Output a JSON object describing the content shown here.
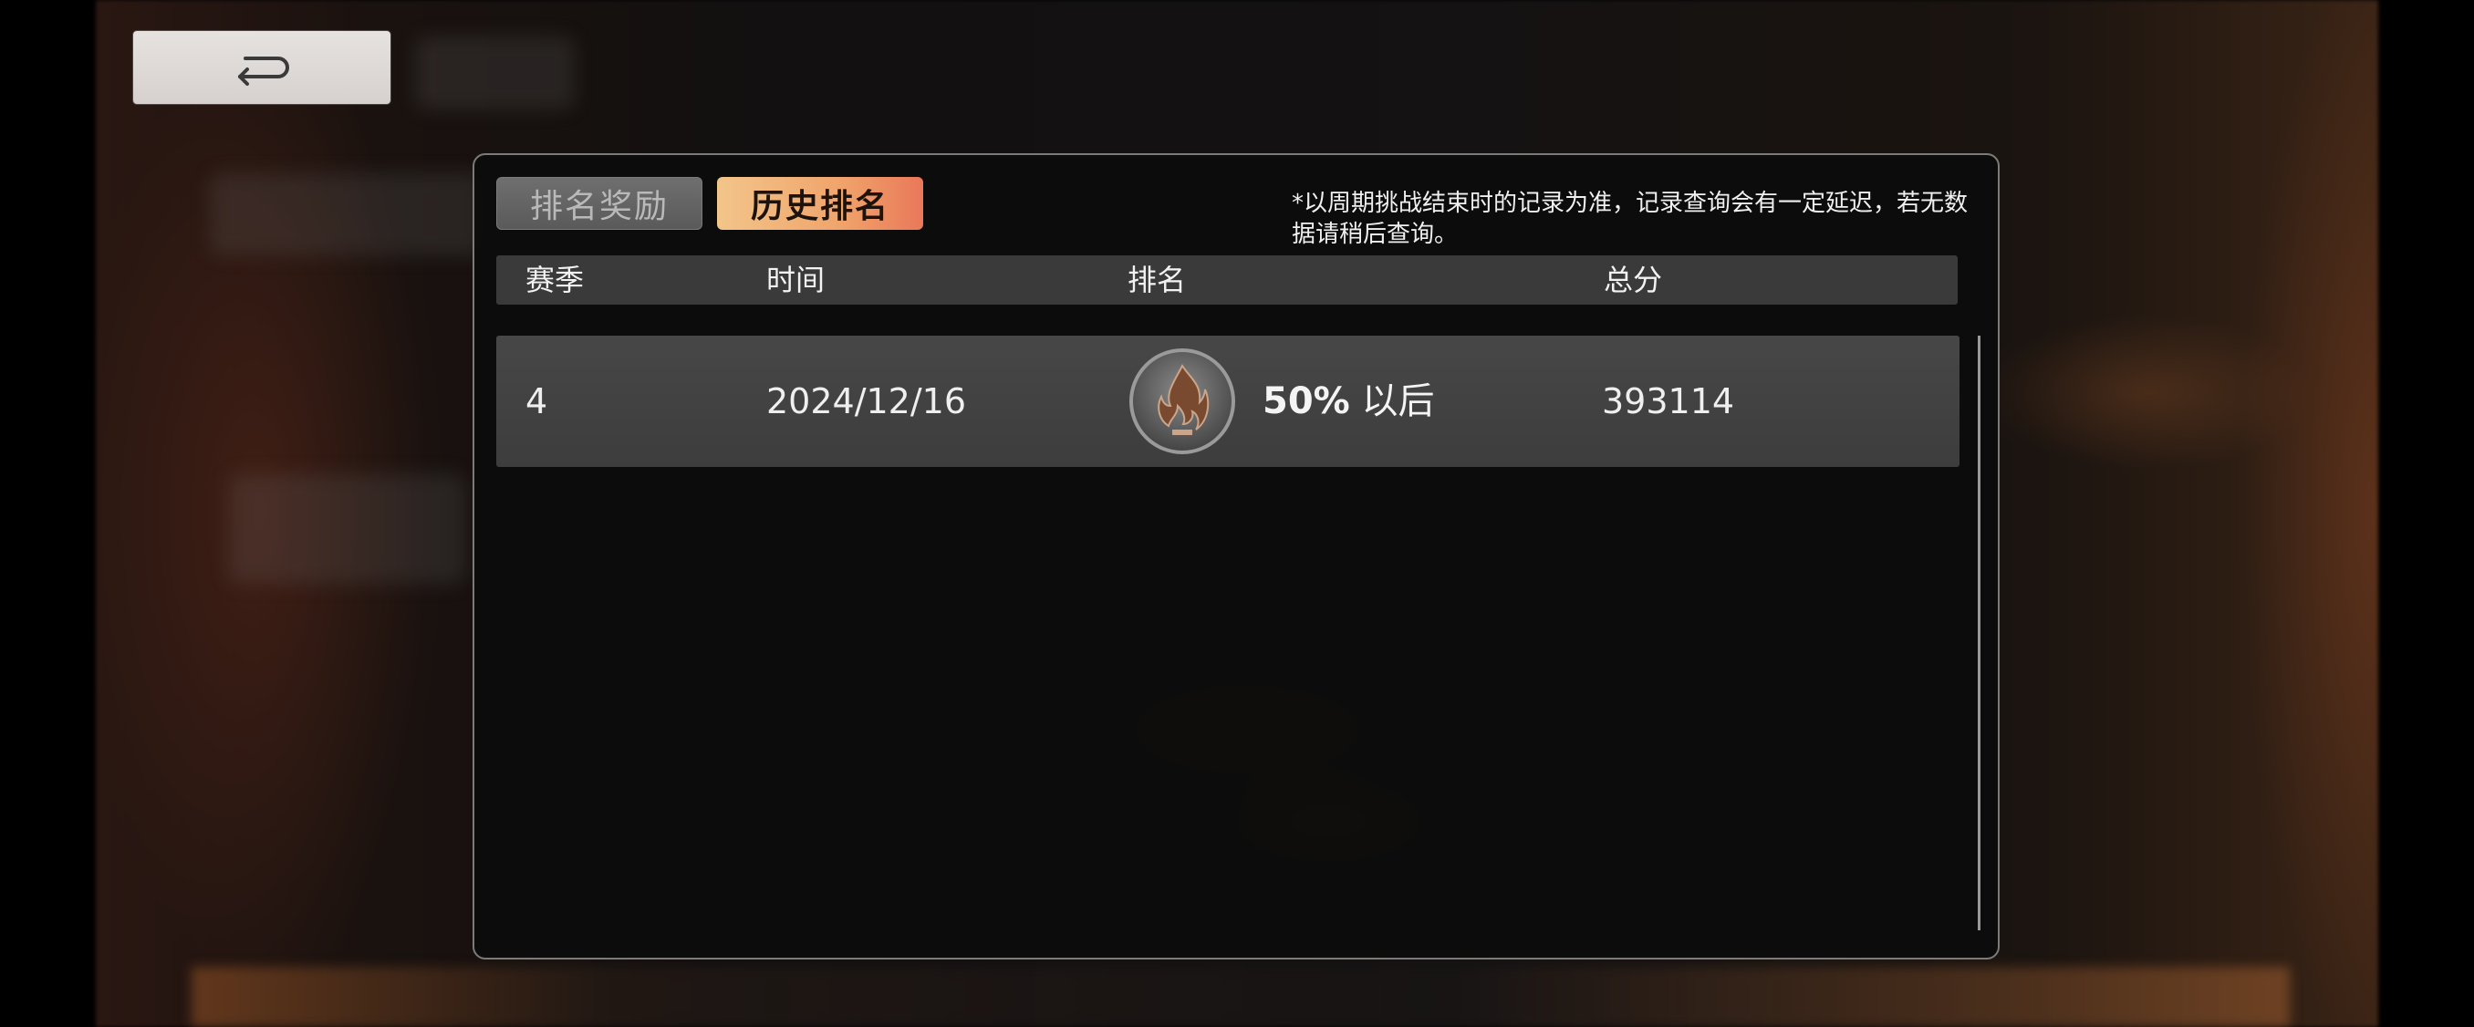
{
  "back_button": {
    "icon": "return-arrow-icon"
  },
  "tabs": [
    {
      "label": "排名奖励",
      "active": false
    },
    {
      "label": "历史排名",
      "active": true
    }
  ],
  "notice": "*以周期挑战结束时的记录为准，记录查询会有一定延迟，若无数据请稍后查询。",
  "table": {
    "columns": [
      "赛季",
      "时间",
      "排名",
      "总分"
    ],
    "rows": [
      {
        "season": "4",
        "date": "2024/12/16",
        "rank_icon": "flame-rank-badge-icon",
        "rank_percent": "50%",
        "rank_suffix": "以后",
        "score": "393114"
      }
    ]
  },
  "colors": {
    "active_tab_start": "#f2c58a",
    "active_tab_end": "#e9785a",
    "panel_border": "#7d7b78"
  }
}
